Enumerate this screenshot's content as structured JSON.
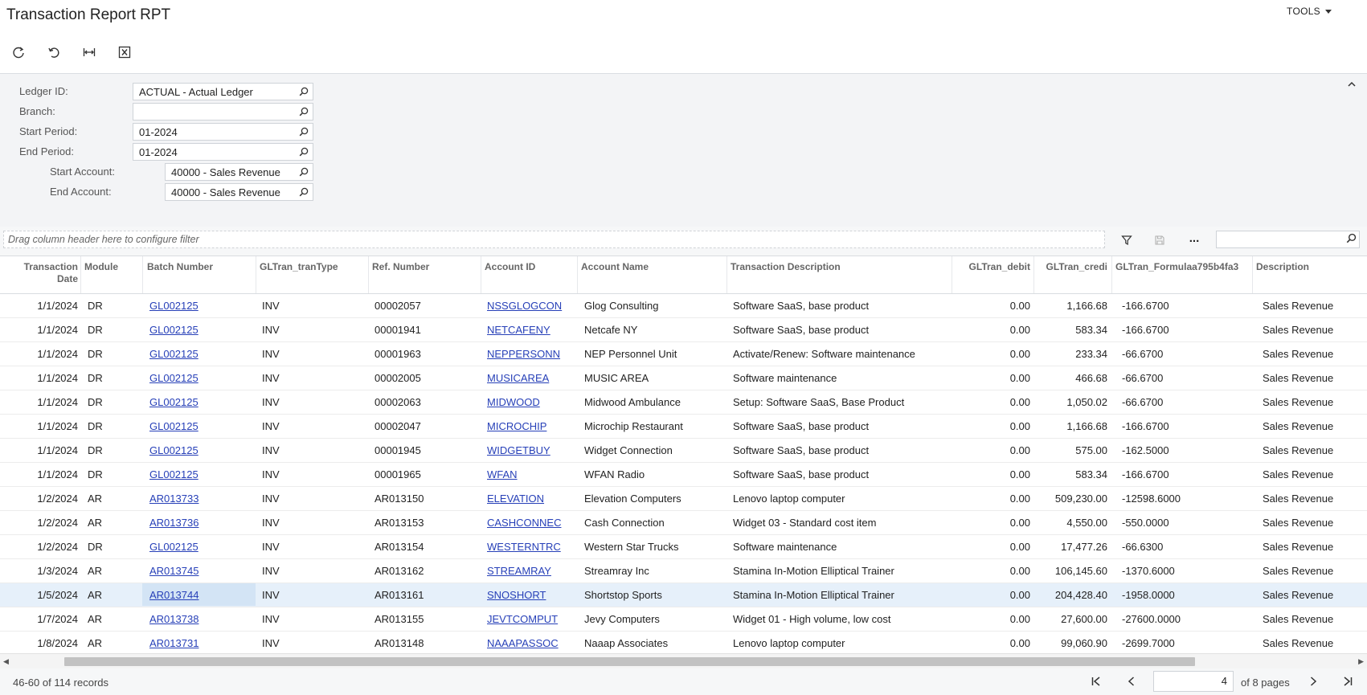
{
  "header": {
    "title": "Transaction Report RPT",
    "tools_label": "TOOLS"
  },
  "toolbar": {
    "buttons": [
      "refresh-icon",
      "undo-icon",
      "fit-columns-icon",
      "excel-export-icon"
    ]
  },
  "form": {
    "ledger_id": {
      "label": "Ledger ID:",
      "value": "ACTUAL - Actual Ledger"
    },
    "branch": {
      "label": "Branch:",
      "value": ""
    },
    "start_period": {
      "label": "Start Period:",
      "value": "01-2024"
    },
    "end_period": {
      "label": "End Period:",
      "value": "01-2024"
    },
    "start_account": {
      "label": "Start Account:",
      "value": "40000 - Sales Revenue"
    },
    "end_account": {
      "label": "End Account:",
      "value": "40000 - Sales Revenue"
    }
  },
  "filterbar": {
    "drag_hint": "Drag column header here to configure filter",
    "more_label": "..."
  },
  "grid": {
    "columns": {
      "date_1": "Transaction",
      "date_2": "Date",
      "module": "Module",
      "batch": "Batch Number",
      "trantype": "GLTran_tranType",
      "ref": "Ref. Number",
      "account": "Account ID",
      "account_name": "Account Name",
      "description_tx": "Transaction Description",
      "debit": "GLTran_debit",
      "credit": "GLTran_credi",
      "formula": "GLTran_Formulaa795b4fa3",
      "description": "Description"
    },
    "rows": [
      {
        "date": "1/1/2024",
        "module": "DR",
        "batch": "GL002125",
        "type": "INV",
        "ref": "00002057",
        "account": "NSSGLOGCON",
        "name": "Glog Consulting",
        "desc": "Software SaaS, base product",
        "debit": "0.00",
        "credit": "1,166.68",
        "formula": "-166.6700",
        "description": "Sales Revenue"
      },
      {
        "date": "1/1/2024",
        "module": "DR",
        "batch": "GL002125",
        "type": "INV",
        "ref": "00001941",
        "account": "NETCAFENY",
        "name": "Netcafe NY",
        "desc": "Software SaaS, base product",
        "debit": "0.00",
        "credit": "583.34",
        "formula": "-166.6700",
        "description": "Sales Revenue"
      },
      {
        "date": "1/1/2024",
        "module": "DR",
        "batch": "GL002125",
        "type": "INV",
        "ref": "00001963",
        "account": "NEPPERSONN",
        "name": "NEP Personnel Unit",
        "desc": "Activate/Renew: Software maintenance",
        "debit": "0.00",
        "credit": "233.34",
        "formula": "-66.6700",
        "description": "Sales Revenue"
      },
      {
        "date": "1/1/2024",
        "module": "DR",
        "batch": "GL002125",
        "type": "INV",
        "ref": "00002005",
        "account": "MUSICAREA",
        "name": "MUSIC AREA",
        "desc": "Software maintenance",
        "debit": "0.00",
        "credit": "466.68",
        "formula": "-66.6700",
        "description": "Sales Revenue"
      },
      {
        "date": "1/1/2024",
        "module": "DR",
        "batch": "GL002125",
        "type": "INV",
        "ref": "00002063",
        "account": "MIDWOOD",
        "name": "Midwood Ambulance",
        "desc": "Setup: Software SaaS, Base Product",
        "debit": "0.00",
        "credit": "1,050.02",
        "formula": "-66.6700",
        "description": "Sales Revenue"
      },
      {
        "date": "1/1/2024",
        "module": "DR",
        "batch": "GL002125",
        "type": "INV",
        "ref": "00002047",
        "account": "MICROCHIP",
        "name": "Microchip Restaurant",
        "desc": "Software SaaS, base product",
        "debit": "0.00",
        "credit": "1,166.68",
        "formula": "-166.6700",
        "description": "Sales Revenue"
      },
      {
        "date": "1/1/2024",
        "module": "DR",
        "batch": "GL002125",
        "type": "INV",
        "ref": "00001945",
        "account": "WIDGETBUY",
        "name": "Widget Connection",
        "desc": "Software SaaS, base product",
        "debit": "0.00",
        "credit": "575.00",
        "formula": "-162.5000",
        "description": "Sales Revenue"
      },
      {
        "date": "1/1/2024",
        "module": "DR",
        "batch": "GL002125",
        "type": "INV",
        "ref": "00001965",
        "account": "WFAN",
        "name": "WFAN Radio",
        "desc": "Software SaaS, base product",
        "debit": "0.00",
        "credit": "583.34",
        "formula": "-166.6700",
        "description": "Sales Revenue"
      },
      {
        "date": "1/2/2024",
        "module": "AR",
        "batch": "AR013733",
        "type": "INV",
        "ref": "AR013150",
        "account": "ELEVATION",
        "name": "Elevation Computers",
        "desc": "Lenovo laptop computer",
        "debit": "0.00",
        "credit": "509,230.00",
        "formula": "-12598.6000",
        "description": "Sales Revenue"
      },
      {
        "date": "1/2/2024",
        "module": "AR",
        "batch": "AR013736",
        "type": "INV",
        "ref": "AR013153",
        "account": "CASHCONNEC",
        "name": "Cash Connection",
        "desc": "Widget 03 - Standard cost item",
        "debit": "0.00",
        "credit": "4,550.00",
        "formula": "-550.0000",
        "description": "Sales Revenue"
      },
      {
        "date": "1/2/2024",
        "module": "DR",
        "batch": "GL002125",
        "type": "INV",
        "ref": "AR013154",
        "account": "WESTERNTRC",
        "name": "Western Star Trucks",
        "desc": "Software maintenance",
        "debit": "0.00",
        "credit": "17,477.26",
        "formula": "-66.6300",
        "description": "Sales Revenue"
      },
      {
        "date": "1/3/2024",
        "module": "AR",
        "batch": "AR013745",
        "type": "INV",
        "ref": "AR013162",
        "account": "STREAMRAY",
        "name": "Streamray Inc",
        "desc": "Stamina In-Motion Elliptical Trainer",
        "debit": "0.00",
        "credit": "106,145.60",
        "formula": "-1370.6000",
        "description": "Sales Revenue"
      },
      {
        "date": "1/5/2024",
        "module": "AR",
        "batch": "AR013744",
        "type": "INV",
        "ref": "AR013161",
        "account": "SNOSHORT",
        "name": "Shortstop Sports",
        "desc": "Stamina In-Motion Elliptical Trainer",
        "debit": "0.00",
        "credit": "204,428.40",
        "formula": "-1958.0000",
        "description": "Sales Revenue",
        "selected": true
      },
      {
        "date": "1/7/2024",
        "module": "AR",
        "batch": "AR013738",
        "type": "INV",
        "ref": "AR013155",
        "account": "JEVTCOMPUT",
        "name": "Jevy Computers",
        "desc": "Widget 01 - High volume, low cost",
        "debit": "0.00",
        "credit": "27,600.00",
        "formula": "-27600.0000",
        "description": "Sales Revenue"
      },
      {
        "date": "1/8/2024",
        "module": "AR",
        "batch": "AR013731",
        "type": "INV",
        "ref": "AR013148",
        "account": "NAAAPASSOC",
        "name": "Naaap Associates",
        "desc": "Lenovo laptop computer",
        "debit": "0.00",
        "credit": "99,060.90",
        "formula": "-2699.7000",
        "description": "Sales Revenue"
      }
    ]
  },
  "footer": {
    "records": "46-60 of 114 records",
    "page": "4",
    "of_pages": "of 8 pages"
  }
}
